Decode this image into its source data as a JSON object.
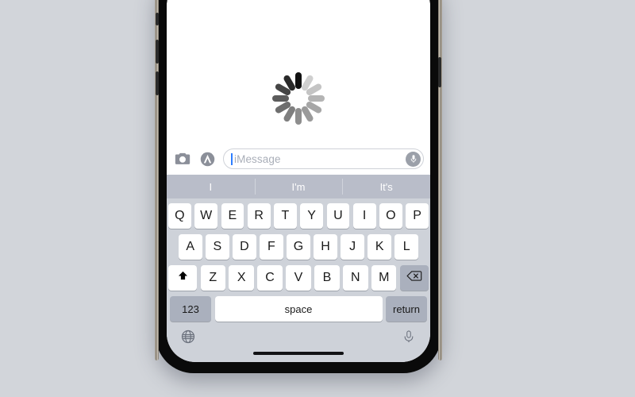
{
  "device": {
    "name": "iphone-mockup",
    "frame_color": "#0a0a0a",
    "screen_background": "#ffffff",
    "page_background": "#d2d5da"
  },
  "conversation": {
    "loading_spinner": {
      "icon": "loading-spinner-icon",
      "spoke_count": 12,
      "spoke_colors": [
        "#111111",
        "#cfcfcf",
        "#c4c4c4",
        "#b4b4b4",
        "#a6a6a6",
        "#9a9a9a",
        "#8e8e8e",
        "#7f7f7f",
        "#6e6e6e",
        "#5c5c5c",
        "#454545",
        "#2a2a2a"
      ]
    }
  },
  "input_bar": {
    "camera_icon": "camera-icon",
    "appstore_icon": "app-store-icon",
    "message_field": {
      "value": "",
      "placeholder": "iMessage",
      "caret_color": "#2d7dff"
    },
    "mic_icon": "microphone-icon"
  },
  "prediction_bar": {
    "background": "#b9bdc9",
    "suggestions": [
      "I",
      "I'm",
      "It's"
    ]
  },
  "keyboard": {
    "background": "#ced2d9",
    "key_color": "#ffffff",
    "modifier_key_color": "#aab0bd",
    "rows": [
      [
        "Q",
        "W",
        "E",
        "R",
        "T",
        "Y",
        "U",
        "I",
        "O",
        "P"
      ],
      [
        "A",
        "S",
        "D",
        "F",
        "G",
        "H",
        "J",
        "K",
        "L"
      ],
      [
        "Z",
        "X",
        "C",
        "V",
        "B",
        "N",
        "M"
      ]
    ],
    "shift_key": {
      "label": "⬆",
      "icon": "shift-arrow-icon"
    },
    "backspace_key": {
      "label": "⌫",
      "icon": "backspace-icon"
    },
    "numeric_key": {
      "label": "123"
    },
    "space_key": {
      "label": "space"
    },
    "return_key": {
      "label": "return"
    }
  },
  "bottom_bar": {
    "globe_icon": "globe-icon",
    "dictation_icon": "microphone-icon",
    "home_indicator": "home-indicator"
  }
}
